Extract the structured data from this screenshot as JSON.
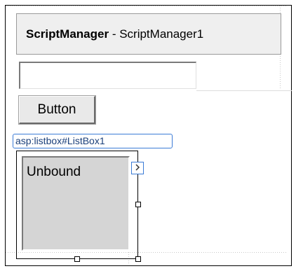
{
  "script_manager": {
    "type_label": "ScriptManager",
    "separator": " - ",
    "id_label": "ScriptManager1"
  },
  "textbox": {
    "value": ""
  },
  "button": {
    "label": "Button"
  },
  "listbox": {
    "tag_label": "asp:listbox#ListBox1",
    "content": "Unbound",
    "smart_tag_icon": "chevron-right-icon"
  },
  "colors": {
    "selection_accent": "#3b7bd6",
    "listbox_fill": "#d5d5d5",
    "control_fill": "#efefef"
  }
}
